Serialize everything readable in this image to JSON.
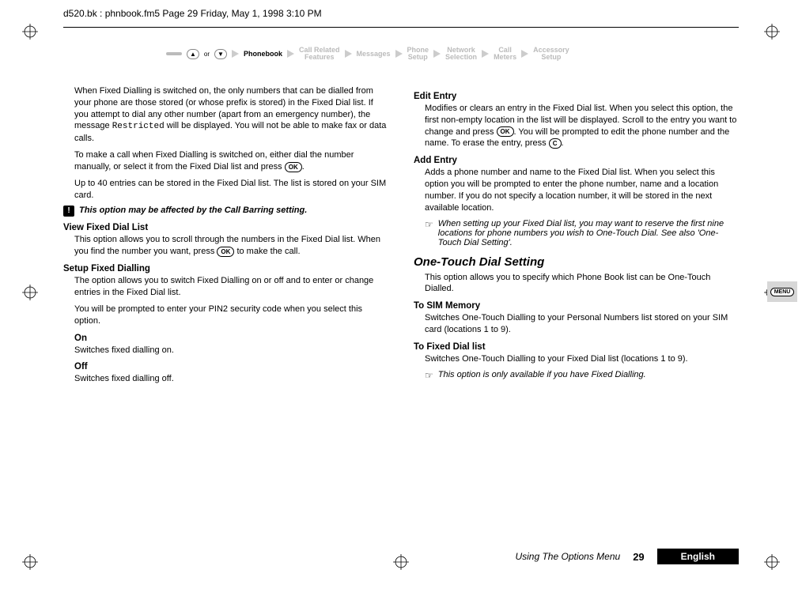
{
  "topline": "d520.bk : phnbook.fm5  Page 29  Friday, May 1, 1998  3:10 PM",
  "crumbs": {
    "or": "or",
    "active": "Phonebook",
    "c1a": "Call Related",
    "c1b": "Features",
    "c2": "Messages",
    "c3a": "Phone",
    "c3b": "Setup",
    "c4a": "Network",
    "c4b": "Selection",
    "c5a": "Call",
    "c5b": "Meters",
    "c6a": "Accessory",
    "c6b": "Setup"
  },
  "left": {
    "p1a": "When Fixed Dialling is switched on, the only numbers that can be dialled from your phone are those stored (or whose prefix is stored) in the Fixed Dial list. If you attempt to dial any other number (apart from an emergency number), the message ",
    "p1mono": "Restricted",
    "p1b": " will be displayed. You will not be able to make fax or data calls.",
    "p2": "To make a call when Fixed Dialling is switched on, either dial the number manually, or select it from the Fixed Dial list and press ",
    "ok": "OK",
    "p3": "Up to 40 entries can be stored in the Fixed Dial list. The list is stored on your SIM card.",
    "note": "This option may be affected by the Call Barring setting.",
    "h_vfdl": "View Fixed Dial List",
    "p4a": "This option allows you to scroll through the numbers in the Fixed Dial list. When you find the number you want, press ",
    "p4b": " to make the call.",
    "h_sfd": "Setup Fixed Dialling",
    "p5": "The option allows you to switch Fixed Dialling on or off and to enter or change entries in the Fixed Dial list.",
    "p6": "You will be prompted to enter your PIN2 security code when you select this option.",
    "h_on": "On",
    "p7": "Switches fixed dialling on.",
    "h_off": "Off",
    "p8": "Switches fixed dialling off."
  },
  "right": {
    "h_edit": "Edit Entry",
    "p1a": "Modifies or clears an entry in the Fixed Dial list. When you select this option, the first non-empty location in the list will be displayed. Scroll to the entry you want to change and press ",
    "p1b": ". You will be prompted to edit the phone number and the name. To erase the entry, press ",
    "c": "C",
    "h_add": "Add Entry",
    "p2": "Adds a phone number and name to the Fixed Dial list. When you select this option you will be prompted to enter the phone number, name and a location number. If you do not specify a location number, it will be stored in the next available location.",
    "note1": "When setting up your Fixed Dial list, you may want to reserve the first nine locations for phone numbers you wish to One-Touch Dial. See also 'One-Touch Dial Setting'.",
    "h3": "One-Touch Dial Setting",
    "p3": "This option allows you to specify which Phone Book list can be One-Touch Dialled.",
    "h_sim": "To SIM Memory",
    "p4": "Switches One-Touch Dialling to your Personal Numbers list stored on your SIM card (locations 1 to 9).",
    "h_fdl": "To Fixed Dial list",
    "p5": "Switches One-Touch Dialling to your Fixed Dial list (locations 1 to 9).",
    "note2": "This option is only available if you have Fixed Dialling."
  },
  "footer": {
    "section": "Using The Options Menu",
    "page": "29",
    "lang": "English"
  },
  "menu": "MENU"
}
